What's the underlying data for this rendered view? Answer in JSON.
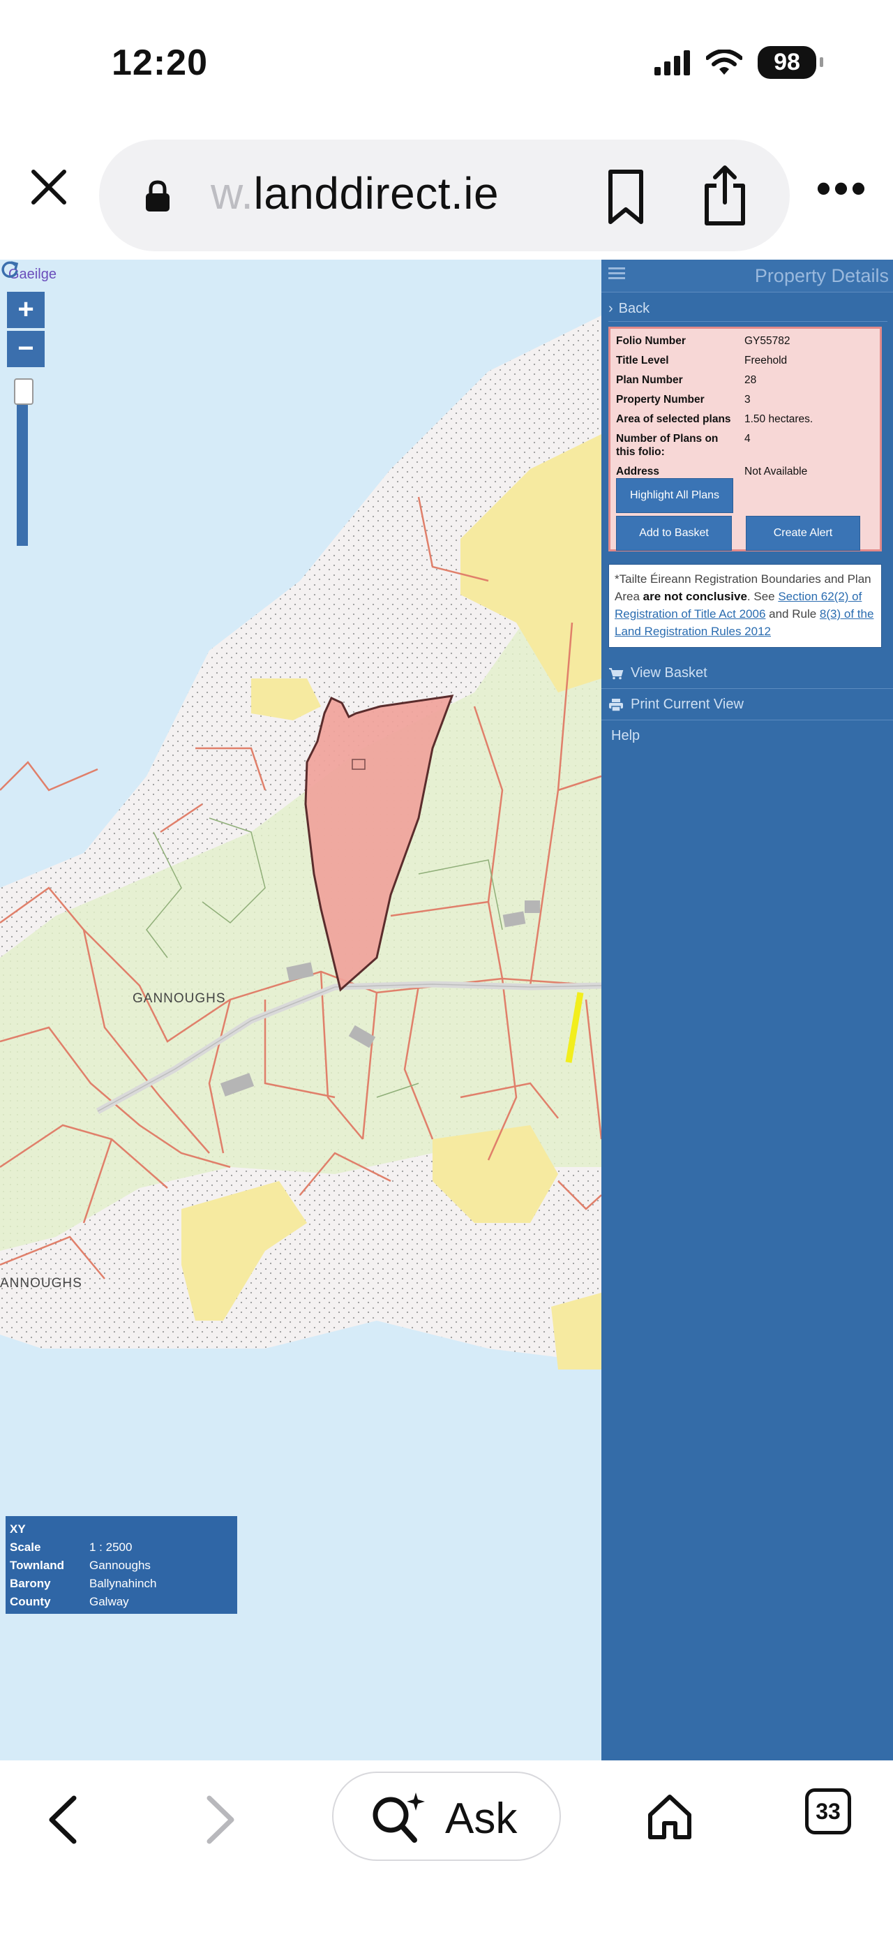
{
  "status_bar": {
    "time": "12:20",
    "battery": "98",
    "icons": [
      "cellular-signal-icon",
      "wifi-icon",
      "battery-icon"
    ]
  },
  "browser": {
    "url_faded": "w.",
    "url_main": "landdirect.ie",
    "icons": [
      "close-icon",
      "lock-icon",
      "bookmark-icon",
      "share-icon",
      "more-icon"
    ],
    "more_label": "•••"
  },
  "map": {
    "language_link": "Gaeilge",
    "zoom_in": "+",
    "zoom_out": "−",
    "labels": {
      "townland_center": "GANNOUGHS",
      "townland_edge": "ANNOUGHS"
    },
    "colors": {
      "sea": "#d6ebf8",
      "grass": "#e8f2d6",
      "beach": "#f6eaa0",
      "rock": "#f3f0f0",
      "boundary": "#e07f6a",
      "selected_plot": "#f0a39b"
    },
    "info": {
      "xy_label": "XY",
      "rows": [
        {
          "key": "Scale",
          "value": "1 : 2500"
        },
        {
          "key": "Townland",
          "value": "Gannoughs"
        },
        {
          "key": "Barony",
          "value": "Ballynahinch"
        },
        {
          "key": "County",
          "value": "Galway"
        }
      ]
    }
  },
  "panel": {
    "title": "Property Details",
    "back_label": "Back",
    "details": [
      {
        "key": "Folio Number",
        "value": "GY55782"
      },
      {
        "key": "Title Level",
        "value": "Freehold"
      },
      {
        "key": "Plan Number",
        "value": "28"
      },
      {
        "key": "Property Number",
        "value": "3"
      },
      {
        "key": "Area of selected plans",
        "value": "1.50 hectares."
      },
      {
        "key": "Number of Plans on this folio:",
        "value": "4"
      },
      {
        "key": "Address",
        "value": "Not Available"
      }
    ],
    "buttons": {
      "highlight": "Highlight All Plans",
      "add_basket": "Add to Basket",
      "create_alert": "Create Alert"
    },
    "disclaimer": {
      "prefix": "*Tailte Éireann Registration Boundaries and Plan Area ",
      "bold": "are not conclusive",
      "middle": ". See ",
      "link1": "Section 62(2) of Registration of Title Act 2006",
      "and": " and Rule ",
      "link2": "8(3) of the Land Registration Rules 2012"
    },
    "menu": {
      "view_basket": "View Basket",
      "print_view": "Print Current View",
      "help": "Help"
    }
  },
  "toolbar": {
    "ask_label": "Ask",
    "tabs_count": "33",
    "icons": [
      "back-arrow-icon",
      "forward-arrow-icon",
      "ai-search-icon",
      "home-icon",
      "tabs-icon"
    ]
  }
}
